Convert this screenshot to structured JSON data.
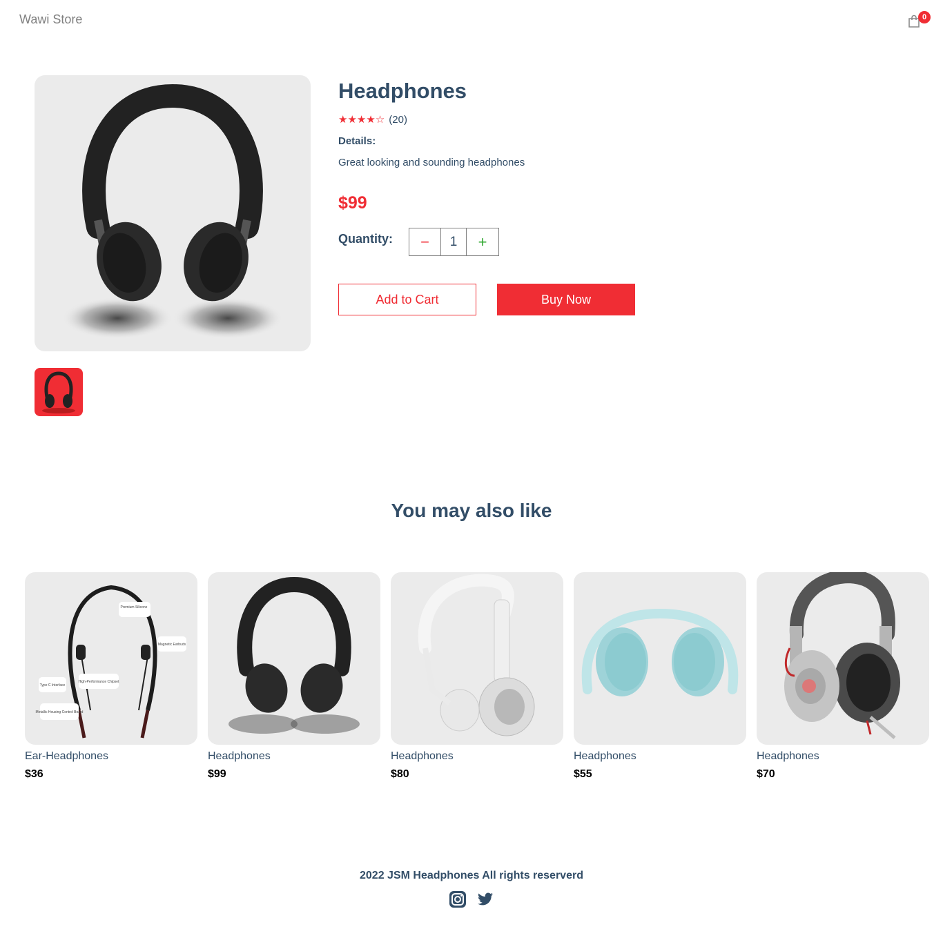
{
  "navbar": {
    "logo": "Wawi Store",
    "cart_count": "0"
  },
  "product": {
    "name": "Headphones",
    "rating": 4,
    "rating_max": 5,
    "review_count": "(20)",
    "details_label": "Details:",
    "details": "Great looking and sounding headphones",
    "price": "$99",
    "quantity_label": "Quantity:",
    "quantity": "1",
    "minus_symbol": "−",
    "plus_symbol": "+",
    "add_to_cart": "Add to Cart",
    "buy_now": "Buy Now"
  },
  "recommendations": {
    "title": "You may also like",
    "items": [
      {
        "name": "Ear-Headphones",
        "price": "$36"
      },
      {
        "name": "Headphones",
        "price": "$99"
      },
      {
        "name": "Headphones",
        "price": "$80"
      },
      {
        "name": "Headphones",
        "price": "$55"
      },
      {
        "name": "Headphones",
        "price": "$70"
      }
    ]
  },
  "neckband_labels": [
    "Premium Silicone",
    "Magnetic Earbuds",
    "Type C Interface",
    "High-Performance Chipset",
    "Metallic Housing Control Board"
  ],
  "footer": {
    "text": "2022 JSM Headphones All rights reserverd",
    "icons": [
      "instagram-icon",
      "twitter-icon"
    ]
  },
  "colors": {
    "accent": "#f02d34",
    "text": "#324d67",
    "card_bg": "#ebebeb",
    "plus": "#31a831"
  }
}
